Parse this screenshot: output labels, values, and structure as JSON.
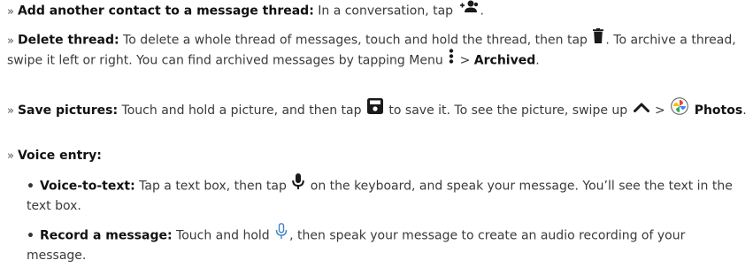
{
  "bullet_glyph": "»",
  "sub_bullet_glyph": "•",
  "items": [
    {
      "title": "Add another contact to a message thread:",
      "text1": " In a conversation, tap ",
      "icon1": "add-contact-icon",
      "text2": "."
    },
    {
      "title": "Delete thread:",
      "text1": " To delete a whole thread of messages, touch and hold the thread, then tap ",
      "icon1": "trash-icon",
      "text2": ". To archive a thread, swipe it left or right. You can find archived messages by tapping Menu ",
      "icon2": "more-vertical-icon",
      "text3": " > ",
      "bold_end": "Archived",
      "text4": "."
    },
    {
      "title": "Save pictures:",
      "text1": " Touch and hold a picture, and then tap ",
      "icon1": "save-icon",
      "text2": " to save it. To see the picture, swipe up ",
      "icon2": "chevron-up-icon",
      "text3": " > ",
      "icon3": "photos-app-icon",
      "bold_end": "Photos",
      "text4": "."
    },
    {
      "title": "Voice entry:"
    }
  ],
  "voice_items": [
    {
      "title": "Voice-to-text:",
      "text1": " Tap a text box, then tap ",
      "icon1": "microphone-icon",
      "text2": " on the keyboard, and speak your message. You’ll see the text in the text box."
    },
    {
      "title": "Record a message:",
      "text1": " Touch and hold ",
      "icon1": "microphone-outline-icon",
      "text2": ", then speak your message to create an audio recording of your message."
    }
  ],
  "colors": {
    "text": "#3a3a3a",
    "bold": "#111111",
    "icon_dark": "#1a1a1a",
    "mic_outline": "#3b82c4"
  }
}
